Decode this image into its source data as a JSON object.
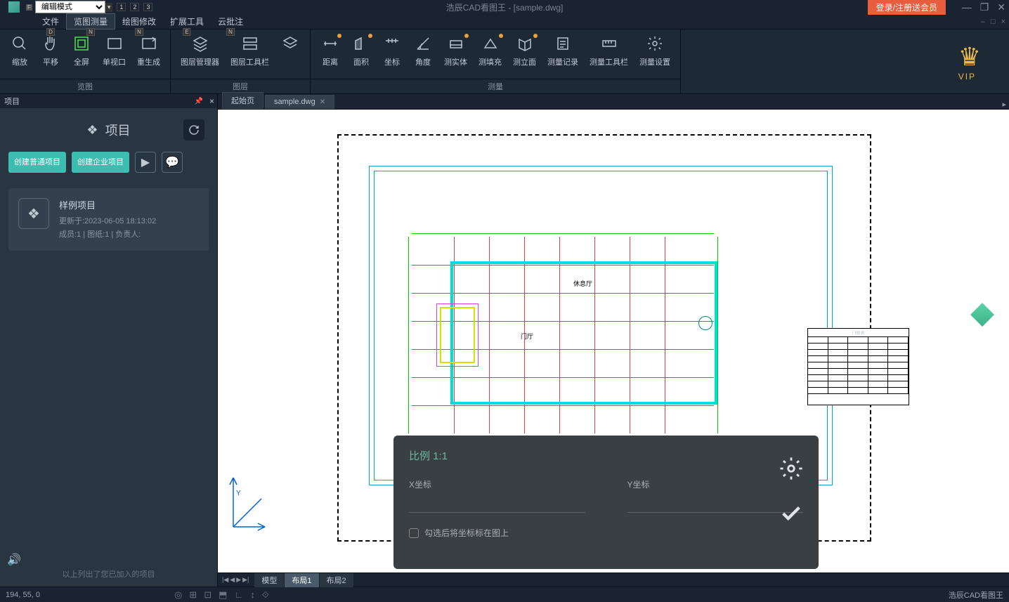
{
  "app": {
    "title": "浩辰CAD看图王 - [sample.dwg]",
    "login_button": "登录/注册送会员",
    "mode": "编辑模式",
    "f_key": "F"
  },
  "menu": {
    "file": "文件",
    "view_measure": "览图测量",
    "draw_edit": "绘图修改",
    "extend_tools": "扩展工具",
    "cloud_annotate": "云批注",
    "hints": {
      "d": "D",
      "n": "N",
      "e": "E"
    }
  },
  "ribbon": {
    "groups": {
      "view": "览图",
      "layer": "图层",
      "measure": "测量"
    },
    "tools": {
      "zoom": "缩放",
      "pan": "平移",
      "fullscreen": "全屏",
      "single_viewport": "单视口",
      "regen": "重生成",
      "layer_manager": "图层管理器",
      "layer_toolbar": "图层工具栏",
      "distance": "距离",
      "area": "面积",
      "coordinate": "坐标",
      "angle": "角度",
      "solid": "测实体",
      "fill": "测填充",
      "elevation": "测立面",
      "record": "测量记录",
      "measure_toolbar": "测量工具栏",
      "measure_settings": "测量设置"
    },
    "vip": "VIP"
  },
  "panel": {
    "header": "项目",
    "title": "项目",
    "create_normal": "创建普通项目",
    "create_enterprise": "创建企业项目",
    "sample": {
      "name": "样例项目",
      "updated": "更新于:2023-06-05 18:13:02",
      "meta": "成员:1 | 图纸:1 | 负责人:"
    },
    "footer": "以上列出了您已加入的项目"
  },
  "tabs": {
    "start": "起始页",
    "sample": "sample.dwg"
  },
  "drawing": {
    "room1": "休息厅",
    "room2": "门厅",
    "schedule_title": "门窗表"
  },
  "popup": {
    "scale": "比例 1:1",
    "x_label": "X坐标",
    "y_label": "Y坐标",
    "checkbox": "勾选后将坐标标在图上"
  },
  "layout_tabs": {
    "model": "模型",
    "layout1": "布局1",
    "layout2": "布局2"
  },
  "status": {
    "coords": "194, 55, 0",
    "app_name": "浩辰CAD看图王"
  },
  "qat": [
    "1",
    "2",
    "3"
  ]
}
